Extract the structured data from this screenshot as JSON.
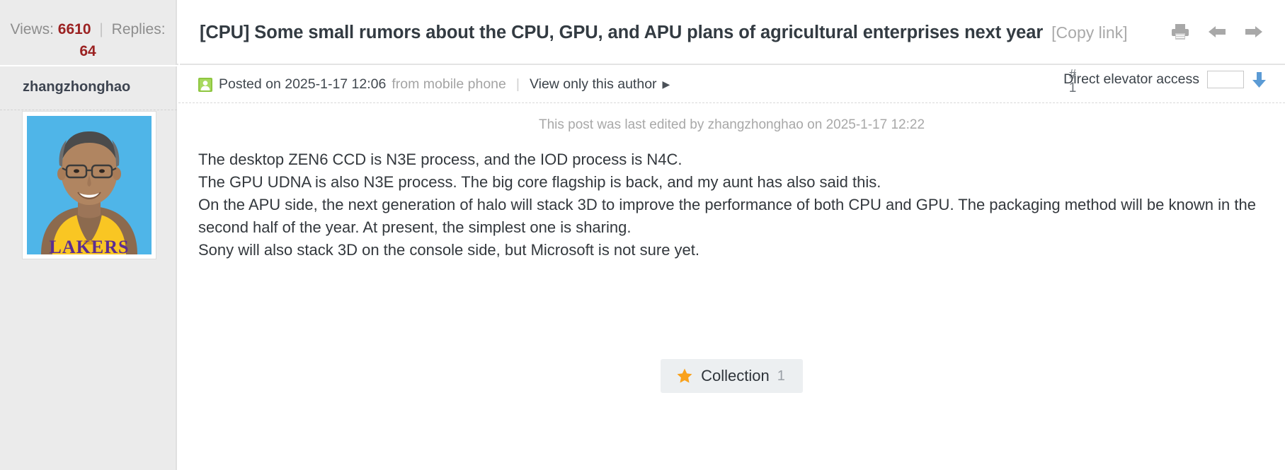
{
  "stats": {
    "views_label": "Views:",
    "views_value": "6610",
    "separator": "|",
    "replies_label": "Replies:",
    "replies_value": "64"
  },
  "header": {
    "title": "[CPU] Some small rumors about the CPU, GPU, and APU plans of agricultural enterprises next year",
    "copy_link": "[Copy link]",
    "actions": [
      {
        "name": "print-icon",
        "title": "Print"
      },
      {
        "name": "arrow-left-icon",
        "title": "Previous"
      },
      {
        "name": "arrow-right-icon",
        "title": "Next"
      }
    ]
  },
  "author": {
    "name": "zhangzhonghao",
    "avatar_alt": "avatar-photo",
    "avatar_bg": "#4fb5e8",
    "jersey_color": "#f9c623",
    "jersey_text": "LAKERS",
    "jersey_text_color": "#5c2d91"
  },
  "post": {
    "badge_icon": "author-badge-icon",
    "posted_prefix": "Posted on 2025-1-17 12:06",
    "posted_source": "from mobile phone",
    "divider": "|",
    "view_author_only": "View only this author",
    "caret": "▶",
    "floor_hash": "#",
    "floor_number": "1",
    "elevator_label": "Direct elevator access",
    "elevator_value": "",
    "elevator_placeholder": "",
    "edit_notice": "This post was last edited by zhangzhonghao on 2025-1-17 12:22",
    "paragraphs": [
      "The desktop ZEN6 CCD is N3E process, and the IOD process is N4C.",
      "The GPU UDNA is also N3E process. The big core flagship is back, and my aunt has also said this.",
      "On the APU side, the next generation of halo will stack 3D to improve the performance of both CPU and GPU. The packaging method will be known in the second half of the year. At present, the simplest one is sharing.",
      "Sony will also stack 3D on the console side, but Microsoft is not sure yet."
    ]
  },
  "collection": {
    "label": "Collection",
    "count": "1",
    "star_color": "#f9a11b"
  },
  "colors": {
    "stat_red": "#9b2222",
    "sidebar_bg": "#ebebeb",
    "title_text": "#333b42",
    "muted_text": "#a4a4a4",
    "elevator_arrow": "#5b9bd5",
    "badge_green": "#8ec640"
  }
}
